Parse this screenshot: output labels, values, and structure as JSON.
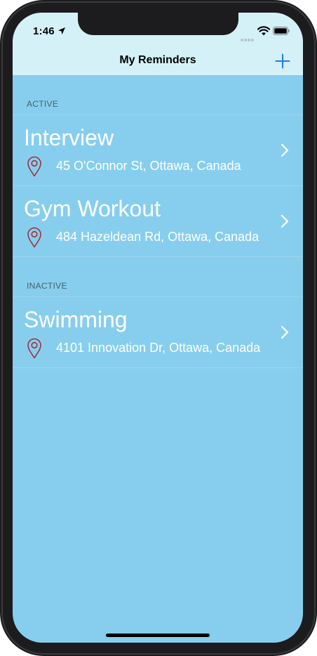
{
  "status_bar": {
    "time": "1:46"
  },
  "nav": {
    "title": "My Reminders",
    "add_icon": "plus-icon"
  },
  "sections": [
    {
      "header": "ACTIVE",
      "items": [
        {
          "title": "Interview",
          "address": "45 O'Connor St, Ottawa, Canada"
        },
        {
          "title": "Gym Workout",
          "address": "484 Hazeldean Rd, Ottawa, Canada"
        }
      ]
    },
    {
      "header": "INACTIVE",
      "items": [
        {
          "title": "Swimming",
          "address": "4101 Innovation Dr, Ottawa, Canada"
        }
      ]
    }
  ],
  "colors": {
    "background": "#87ceee",
    "header_bar": "#d5f1f8",
    "accent": "#1a7cf5",
    "pin": "#a2303c"
  }
}
